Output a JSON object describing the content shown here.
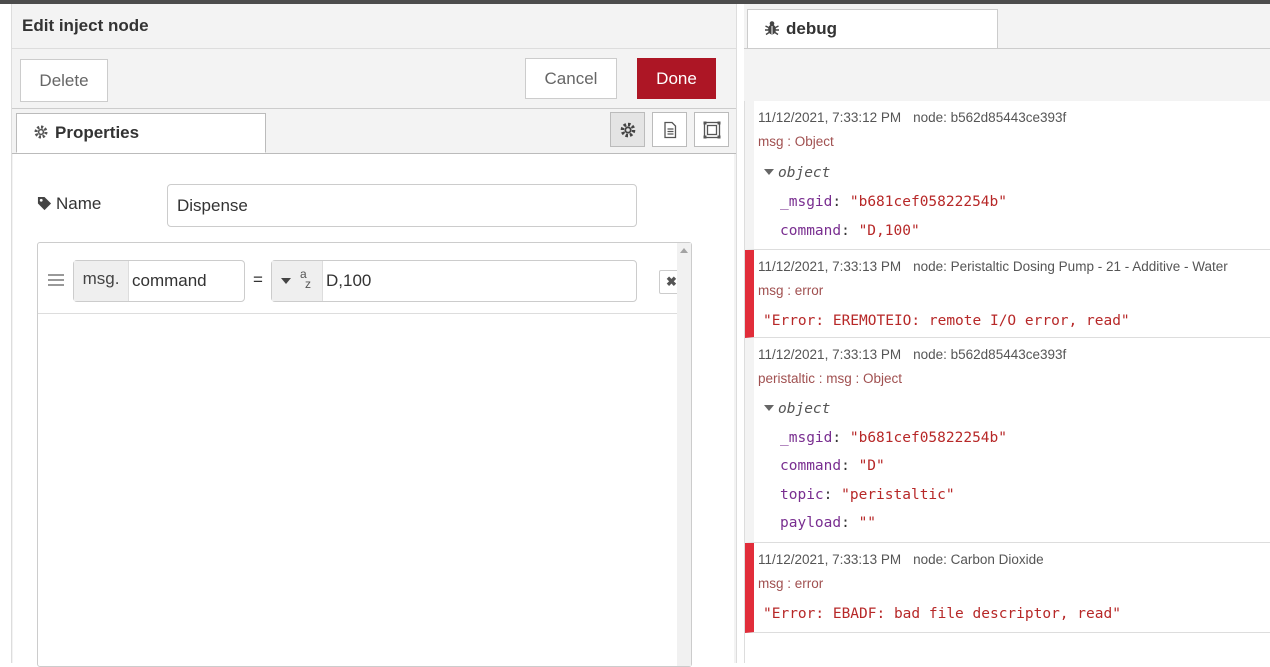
{
  "editor": {
    "title": "Edit inject node",
    "delete_label": "Delete",
    "cancel_label": "Cancel",
    "done_label": "Done",
    "properties_tab": "Properties",
    "name_label": "Name",
    "name_value": "Dispense",
    "prop_prefix": "msg.",
    "prop_name": "command",
    "equals": "=",
    "type_symbol_a": "a",
    "type_symbol_z": "z",
    "prop_value": "D,100",
    "remove_symbol": "✖"
  },
  "debug": {
    "tab_label": "debug",
    "messages": [
      {
        "timestamp": "11/12/2021, 7:33:12 PM",
        "node": "node: b562d85443ce393f",
        "topic": "msg : Object",
        "object_label": "object",
        "fields": [
          {
            "key": "_msgid",
            "value": "\"b681cef05822254b\""
          },
          {
            "key": "command",
            "value": "\"D,100\""
          }
        ]
      },
      {
        "timestamp": "11/12/2021, 7:33:13 PM",
        "node": "node: Peristaltic Dosing Pump - 21 - Additive - Water",
        "topic": "msg : error",
        "error": "\"Error: EREMOTEIO: remote I/O error, read\""
      },
      {
        "timestamp": "11/12/2021, 7:33:13 PM",
        "node": "node: b562d85443ce393f",
        "topic": "peristaltic : msg : Object",
        "object_label": "object",
        "fields": [
          {
            "key": "_msgid",
            "value": "\"b681cef05822254b\""
          },
          {
            "key": "command",
            "value": "\"D\""
          },
          {
            "key": "topic",
            "value": "\"peristaltic\""
          },
          {
            "key": "payload",
            "value": "\"\""
          }
        ]
      },
      {
        "timestamp": "11/12/2021, 7:33:13 PM",
        "node": "node: Carbon Dioxide",
        "topic": "msg : error",
        "error": "\"Error: EBADF: bad file descriptor, read\""
      }
    ]
  },
  "colors": {
    "done_button": "#ad1625",
    "error_marker": "#e12d3a",
    "key_color": "#792e90",
    "string_color": "#b72828"
  }
}
